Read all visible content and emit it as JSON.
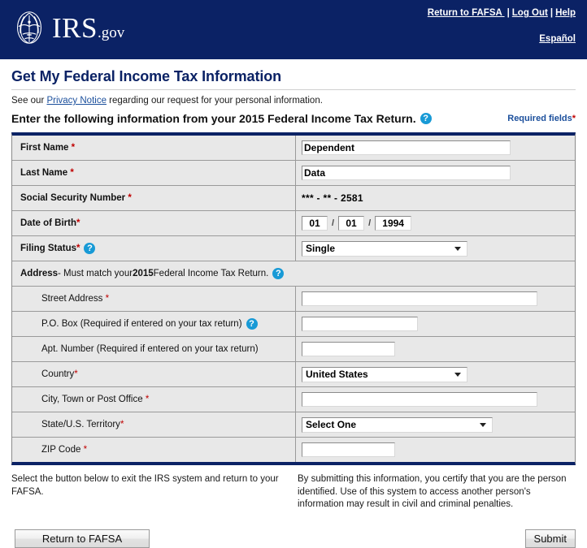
{
  "header": {
    "logo_text": "IRS",
    "logo_suffix": ".gov",
    "logo_icon": "irs-eagle-scales-emblem",
    "links": [
      {
        "label": "Return to FAFSA ",
        "name": "return-to-fafsa-link"
      },
      {
        "label": "Log Out",
        "name": "log-out-link"
      },
      {
        "label": "Help",
        "name": "help-link"
      }
    ],
    "separator": "|",
    "espanol": "Español"
  },
  "page": {
    "title": "Get My Federal Income Tax Information",
    "privacy_prefix": "See our ",
    "privacy_link": "Privacy Notice",
    "privacy_suffix": " regarding our request for your personal information.",
    "instruction": "Enter the following information from your 2015 Federal Income Tax Return.",
    "required_fields_label": "Required fields",
    "required_star": "*"
  },
  "form": {
    "rows": [
      {
        "name": "first-name",
        "label": "First Name",
        "required": true,
        "type": "text",
        "value": "Dependent"
      },
      {
        "name": "last-name",
        "label": "Last Name",
        "required": true,
        "type": "text",
        "value": "Data"
      },
      {
        "name": "social-security-number",
        "label": "Social Security Number",
        "required": true,
        "type": "static",
        "value": "*** - ** - 2581"
      },
      {
        "name": "date-of-birth",
        "label": "Date of Birth ",
        "required": true,
        "type": "date",
        "month": "01",
        "day": "01",
        "year": "1994",
        "separator": "/"
      },
      {
        "name": "filing-status",
        "label": "Filing Status ",
        "required": true,
        "help": true,
        "type": "select",
        "value": "Single"
      }
    ],
    "address_header": {
      "name": "address-section-header",
      "strong": "Address",
      "mid": " - Must match your ",
      "year": "2015",
      "tail": " Federal Income Tax Return.",
      "help": true
    },
    "address_rows": [
      {
        "name": "street-address",
        "label": "Street Address",
        "required": true,
        "type": "text",
        "value": "",
        "width": "w-street"
      },
      {
        "name": "po-box",
        "label": "P.O. Box (Required if entered on your tax return)",
        "required": false,
        "help": true,
        "type": "text",
        "value": "",
        "width": "w-pobox"
      },
      {
        "name": "apt-number",
        "label": "Apt. Number (Required if entered on your tax return)",
        "required": false,
        "type": "text",
        "value": "",
        "width": "w-apt"
      },
      {
        "name": "country",
        "label": "Country",
        "required": true,
        "type": "select",
        "value": "United States",
        "width": "w-sel-country"
      },
      {
        "name": "city-town-or-post-office",
        "label": "City, Town or Post Office",
        "required": true,
        "type": "text",
        "value": "",
        "width": "w-city"
      },
      {
        "name": "state-us-territory",
        "label": "State/U.S. Territory",
        "required": true,
        "type": "select",
        "value": "Select One",
        "width": "w-sel-state"
      },
      {
        "name": "zip-code",
        "label": "ZIP Code",
        "required": true,
        "type": "text",
        "value": "",
        "width": "w-zip"
      }
    ]
  },
  "footer": {
    "left_text": "Select the button below to exit the IRS system and return to your FAFSA.",
    "right_text": "By submitting this information, you certify that you are the person identified. Use of this system to access another person's information may result in civil and criminal penalties.",
    "return_button": "Return to FAFSA",
    "submit_button": "Submit"
  },
  "colors": {
    "navy": "#0b2265",
    "link_blue": "#1b4f9c",
    "required_red": "#c00000",
    "help_icon_blue": "#189ad6",
    "row_gray": "#e8e8e8"
  }
}
